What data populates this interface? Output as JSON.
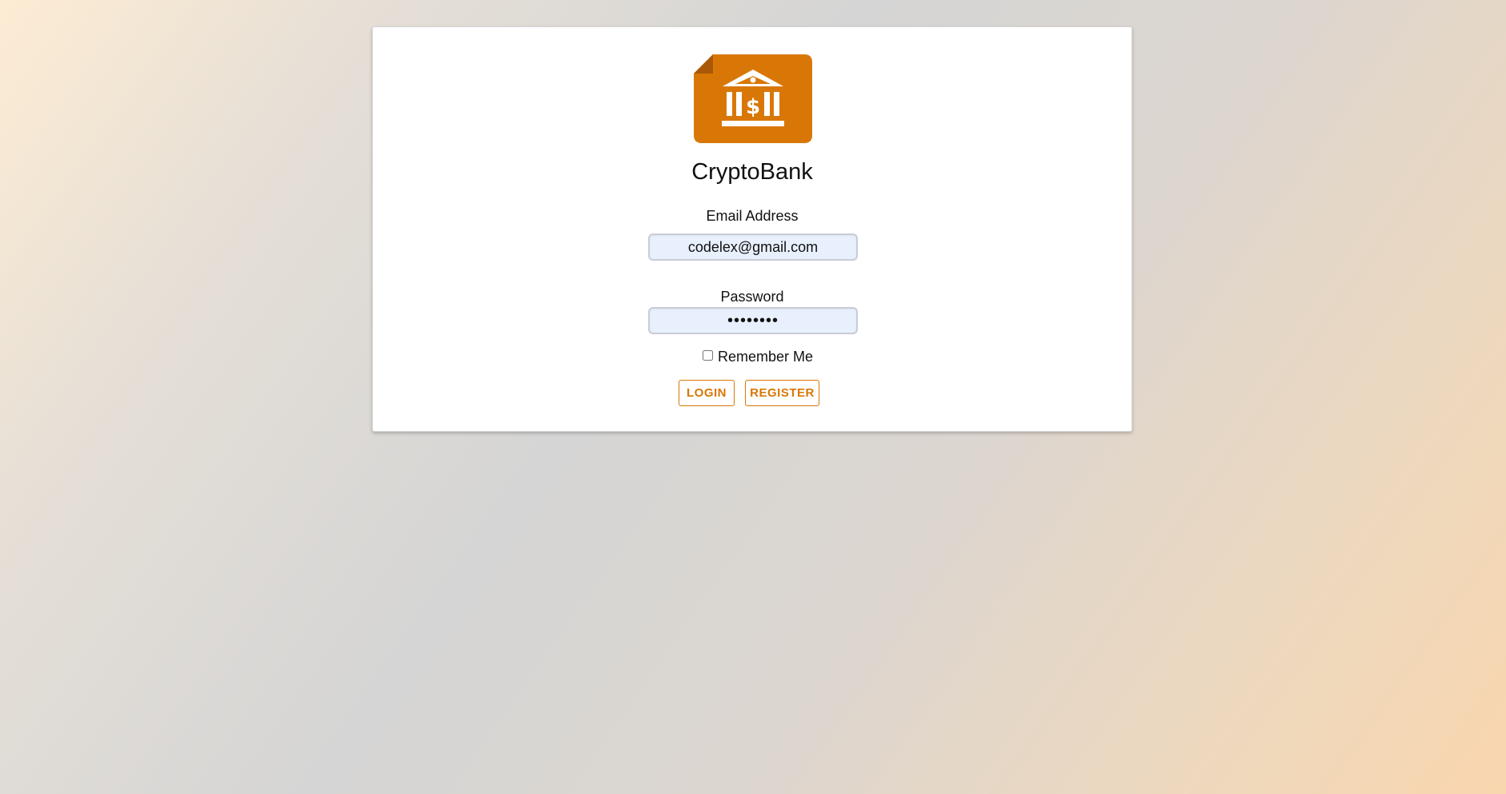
{
  "app": {
    "title": "CryptoBank",
    "logo_icon": "bank-dollar-icon",
    "accent_color": "#d97706"
  },
  "form": {
    "email_label": "Email Address",
    "email_value": "codelex@gmail.com",
    "password_label": "Password",
    "password_value": "password",
    "remember_label": "Remember Me",
    "remember_checked": false
  },
  "buttons": {
    "login_label": "LOGIN",
    "register_label": "REGISTER"
  }
}
